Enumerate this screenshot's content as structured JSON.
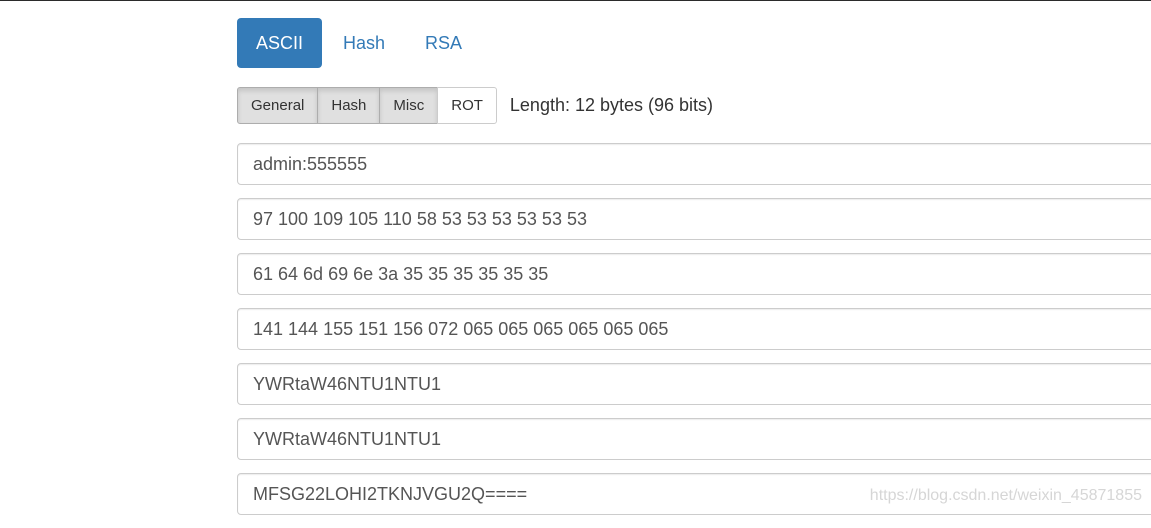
{
  "main_tabs": [
    {
      "label": "ASCII",
      "active": true
    },
    {
      "label": "Hash",
      "active": false
    },
    {
      "label": "RSA",
      "active": false
    }
  ],
  "sub_tabs": [
    {
      "label": "General",
      "active": true
    },
    {
      "label": "Hash",
      "active": true
    },
    {
      "label": "Misc",
      "active": true
    },
    {
      "label": "ROT",
      "active": false
    }
  ],
  "length_text": "Length: 12 bytes (96 bits)",
  "fields": {
    "text": "admin:555555",
    "decimal": "97 100 109 105 110 58 53 53 53 53 53 53",
    "hex": "61 64 6d 69 6e 3a 35 35 35 35 35 35",
    "octal": "141 144 155 151 156 072 065 065 065 065 065 065",
    "base64": "YWRtaW46NTU1NTU1",
    "base64_alt": "YWRtaW46NTU1NTU1",
    "base32": "MFSG22LOHI2TKNJVGU2Q===="
  },
  "watermark": "https://blog.csdn.net/weixin_45871855",
  "colors": {
    "accent": "#337ab7",
    "active_btn_bg": "#e0e0e0",
    "border": "#cccccc",
    "input_text": "#555555"
  }
}
